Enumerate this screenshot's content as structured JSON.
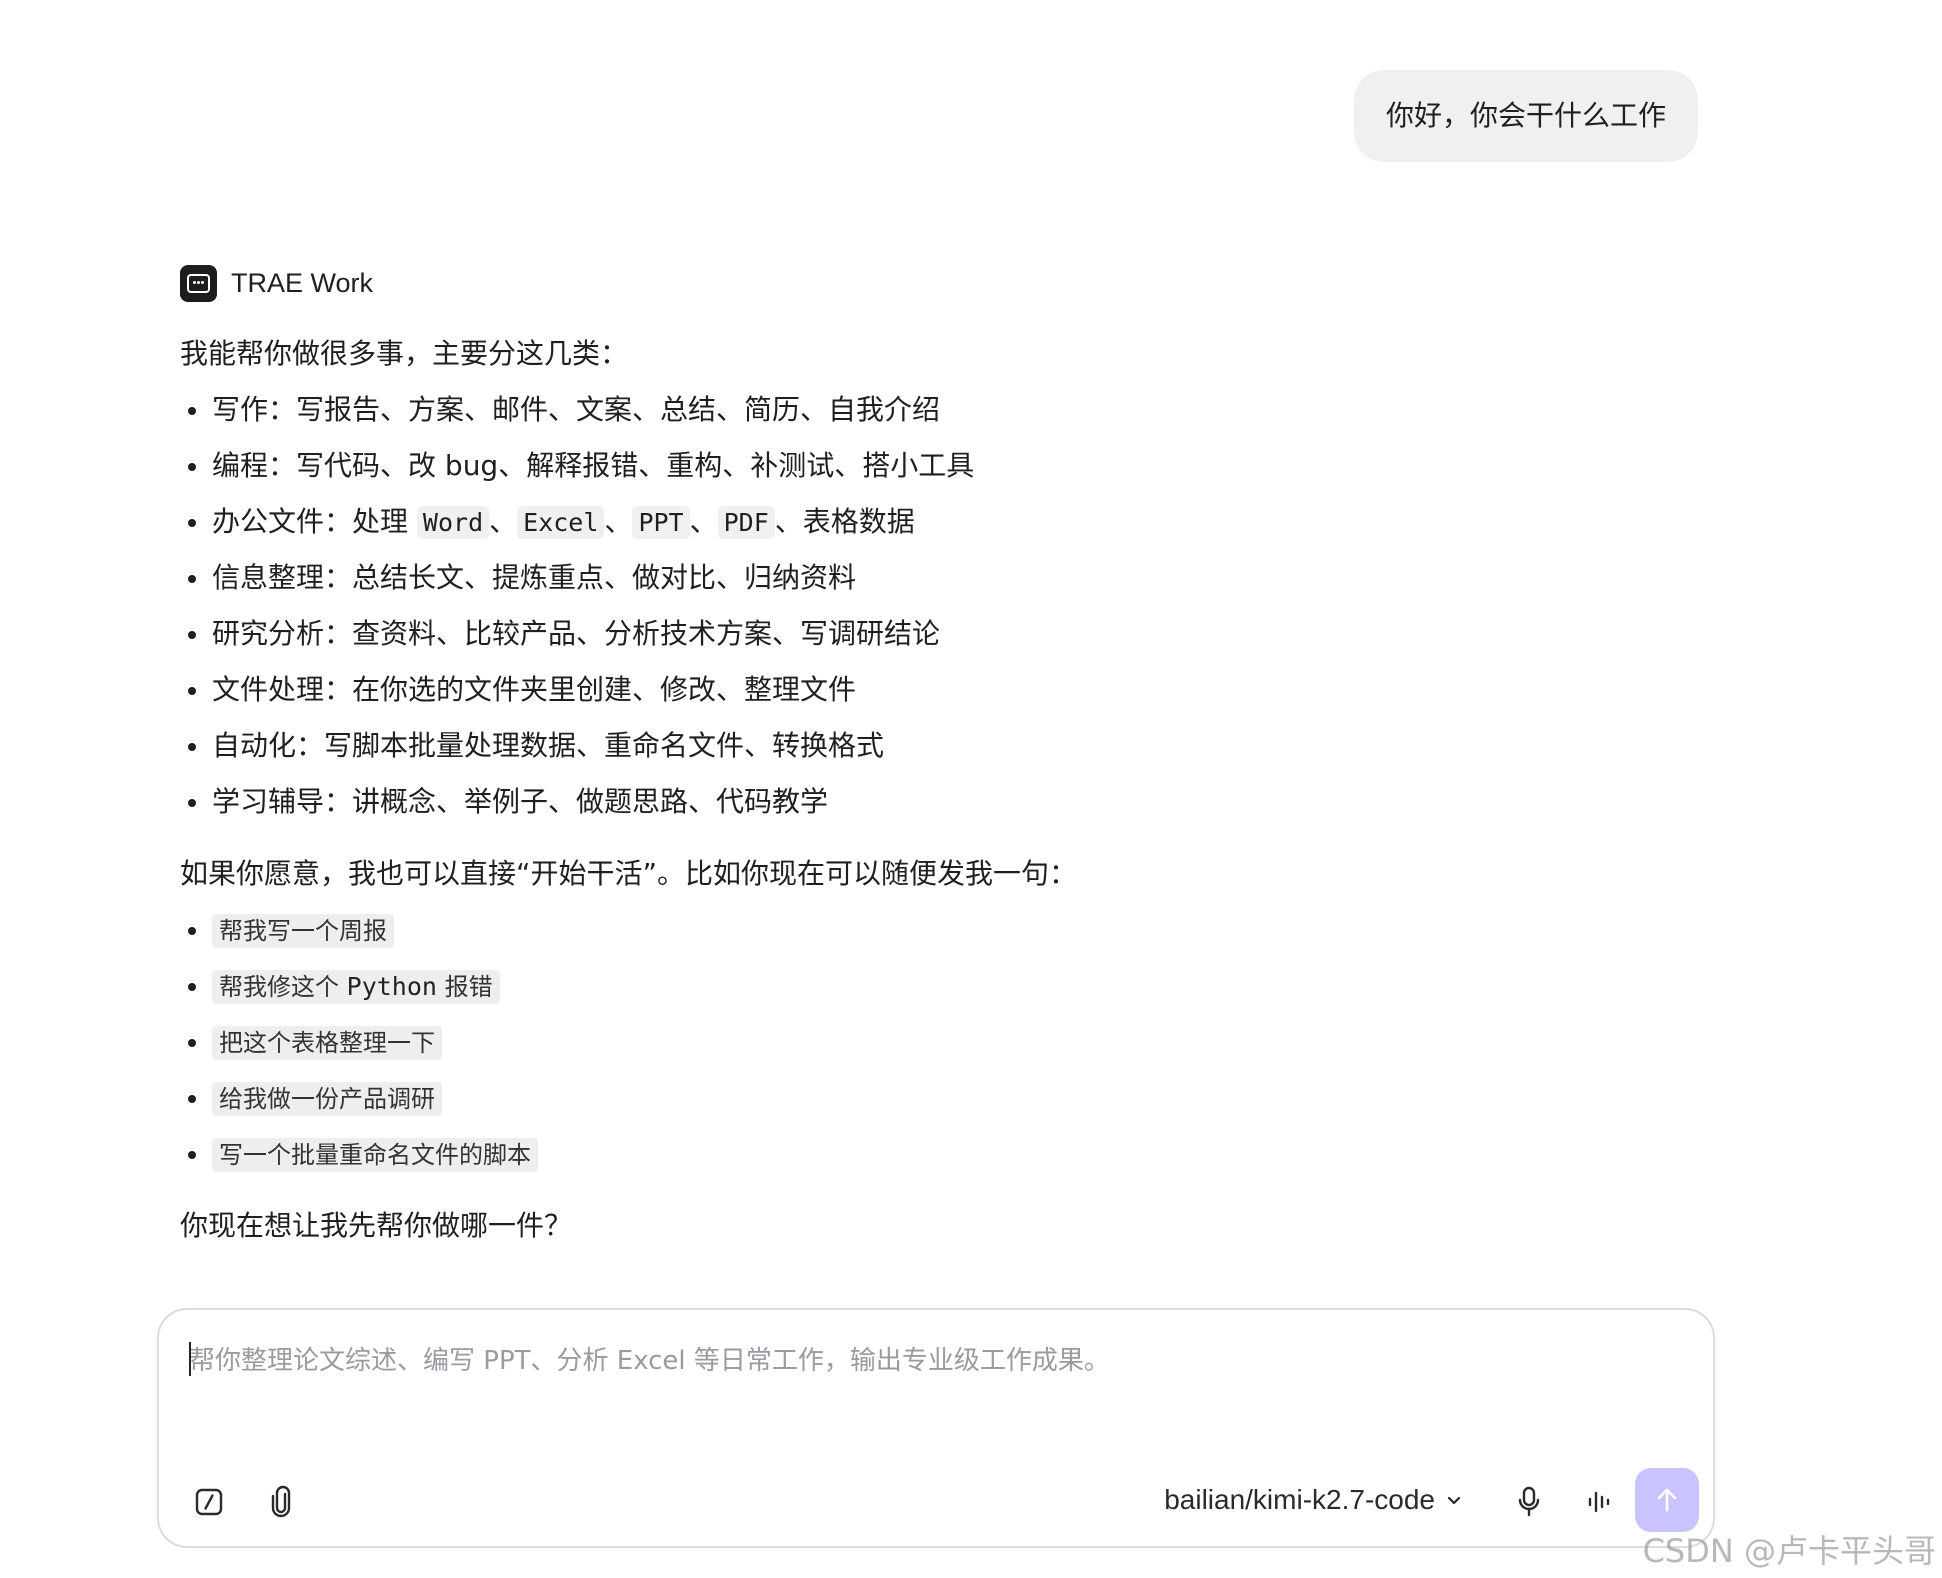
{
  "user_message": "你好，你会干什么工作",
  "assistant": {
    "name": "TRAE Work",
    "intro": "我能帮你做很多事，主要分这几类：",
    "capabilities": [
      {
        "label": "写作：",
        "text": "写报告、方案、邮件、文案、总结、简历、自我介绍"
      },
      {
        "label": "编程：",
        "text": "写代码、改 bug、解释报错、重构、补测试、搭小工具"
      },
      {
        "label": "办公文件：",
        "text_before": "处理 ",
        "codes": [
          "Word",
          "Excel",
          "PPT",
          "PDF"
        ],
        "sep": "、",
        "text_after": "、表格数据"
      },
      {
        "label": "信息整理：",
        "text": "总结长文、提炼重点、做对比、归纳资料"
      },
      {
        "label": "研究分析：",
        "text": "查资料、比较产品、分析技术方案、写调研结论"
      },
      {
        "label": "文件处理：",
        "text": "在你选的文件夹里创建、修改、整理文件"
      },
      {
        "label": "自动化：",
        "text": "写脚本批量处理数据、重命名文件、转换格式"
      },
      {
        "label": "学习辅导：",
        "text": "讲概念、举例子、做题思路、代码教学"
      }
    ],
    "suggest_intro": "如果你愿意，我也可以直接“开始干活”。比如你现在可以随便发我一句：",
    "suggestions": [
      {
        "text": "帮我写一个周报"
      },
      {
        "pre": "帮我修这个 ",
        "mono": "Python",
        "post": " 报错"
      },
      {
        "text": "把这个表格整理一下"
      },
      {
        "text": "给我做一份产品调研"
      },
      {
        "text": "写一个批量重命名文件的脚本"
      }
    ],
    "closing": "你现在想让我先帮你做哪一件？"
  },
  "composer": {
    "placeholder": "帮你整理论文综述、编写 PPT、分析 Excel 等日常工作，输出专业级工作成果。",
    "value": "",
    "model": "bailian/kimi-k2.7-code",
    "icons": {
      "command": "slash-command-icon",
      "attach": "paperclip-icon",
      "mic": "microphone-icon",
      "voice": "voice-wave-icon",
      "send": "arrow-up-icon",
      "model_dropdown": "chevron-down-icon"
    },
    "send_color": "#c9c3ff"
  },
  "watermark": "CSDN @卢卡平头哥"
}
